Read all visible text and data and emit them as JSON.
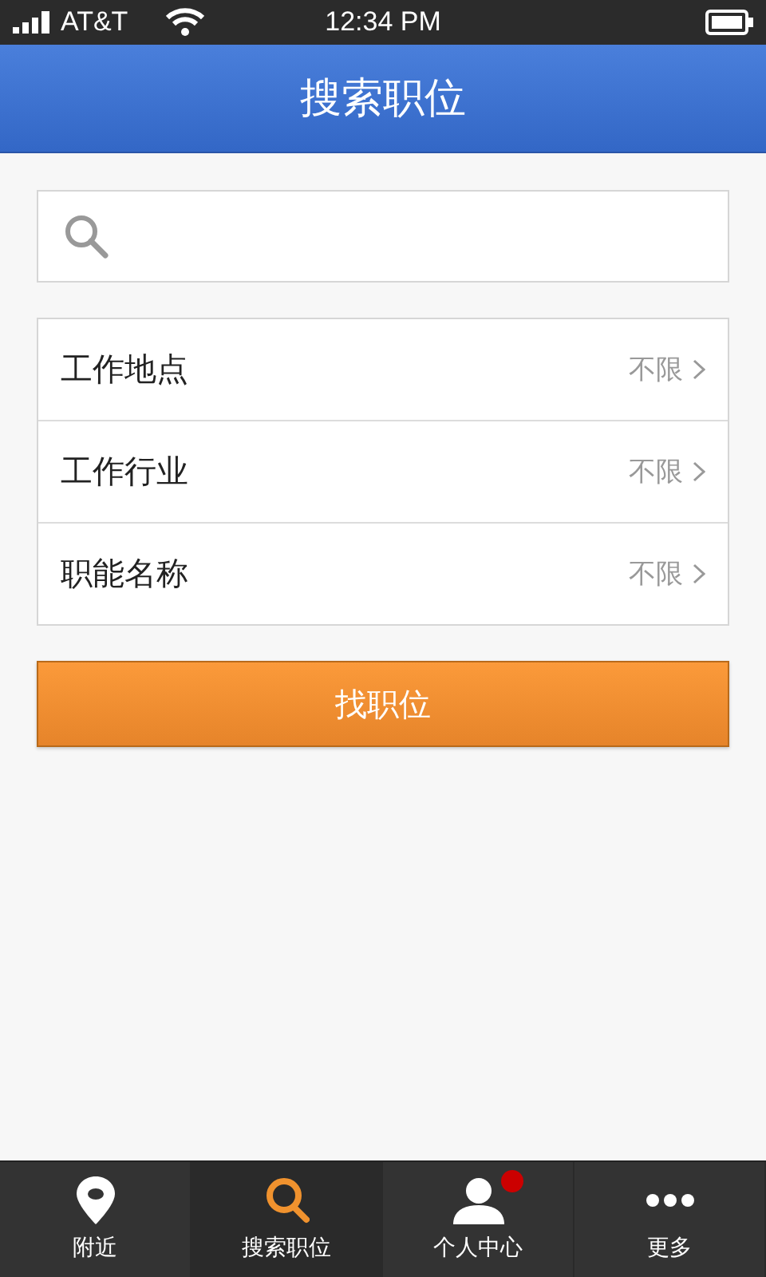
{
  "status_bar": {
    "carrier": "AT&T",
    "time": "12:34 PM"
  },
  "header": {
    "title": "搜索职位"
  },
  "filters": [
    {
      "label": "工作地点",
      "value": "不限"
    },
    {
      "label": "工作行业",
      "value": "不限"
    },
    {
      "label": "职能名称",
      "value": "不限"
    }
  ],
  "submit_button": "找职位",
  "tabs": [
    {
      "kind": "pin",
      "label": "附近",
      "selected": false,
      "notification": false
    },
    {
      "kind": "search",
      "label": "搜索职位",
      "selected": true,
      "notification": false
    },
    {
      "kind": "person",
      "label": "个人中心",
      "selected": false,
      "notification": true
    },
    {
      "kind": "more",
      "label": "更多",
      "selected": false,
      "notification": false
    }
  ]
}
